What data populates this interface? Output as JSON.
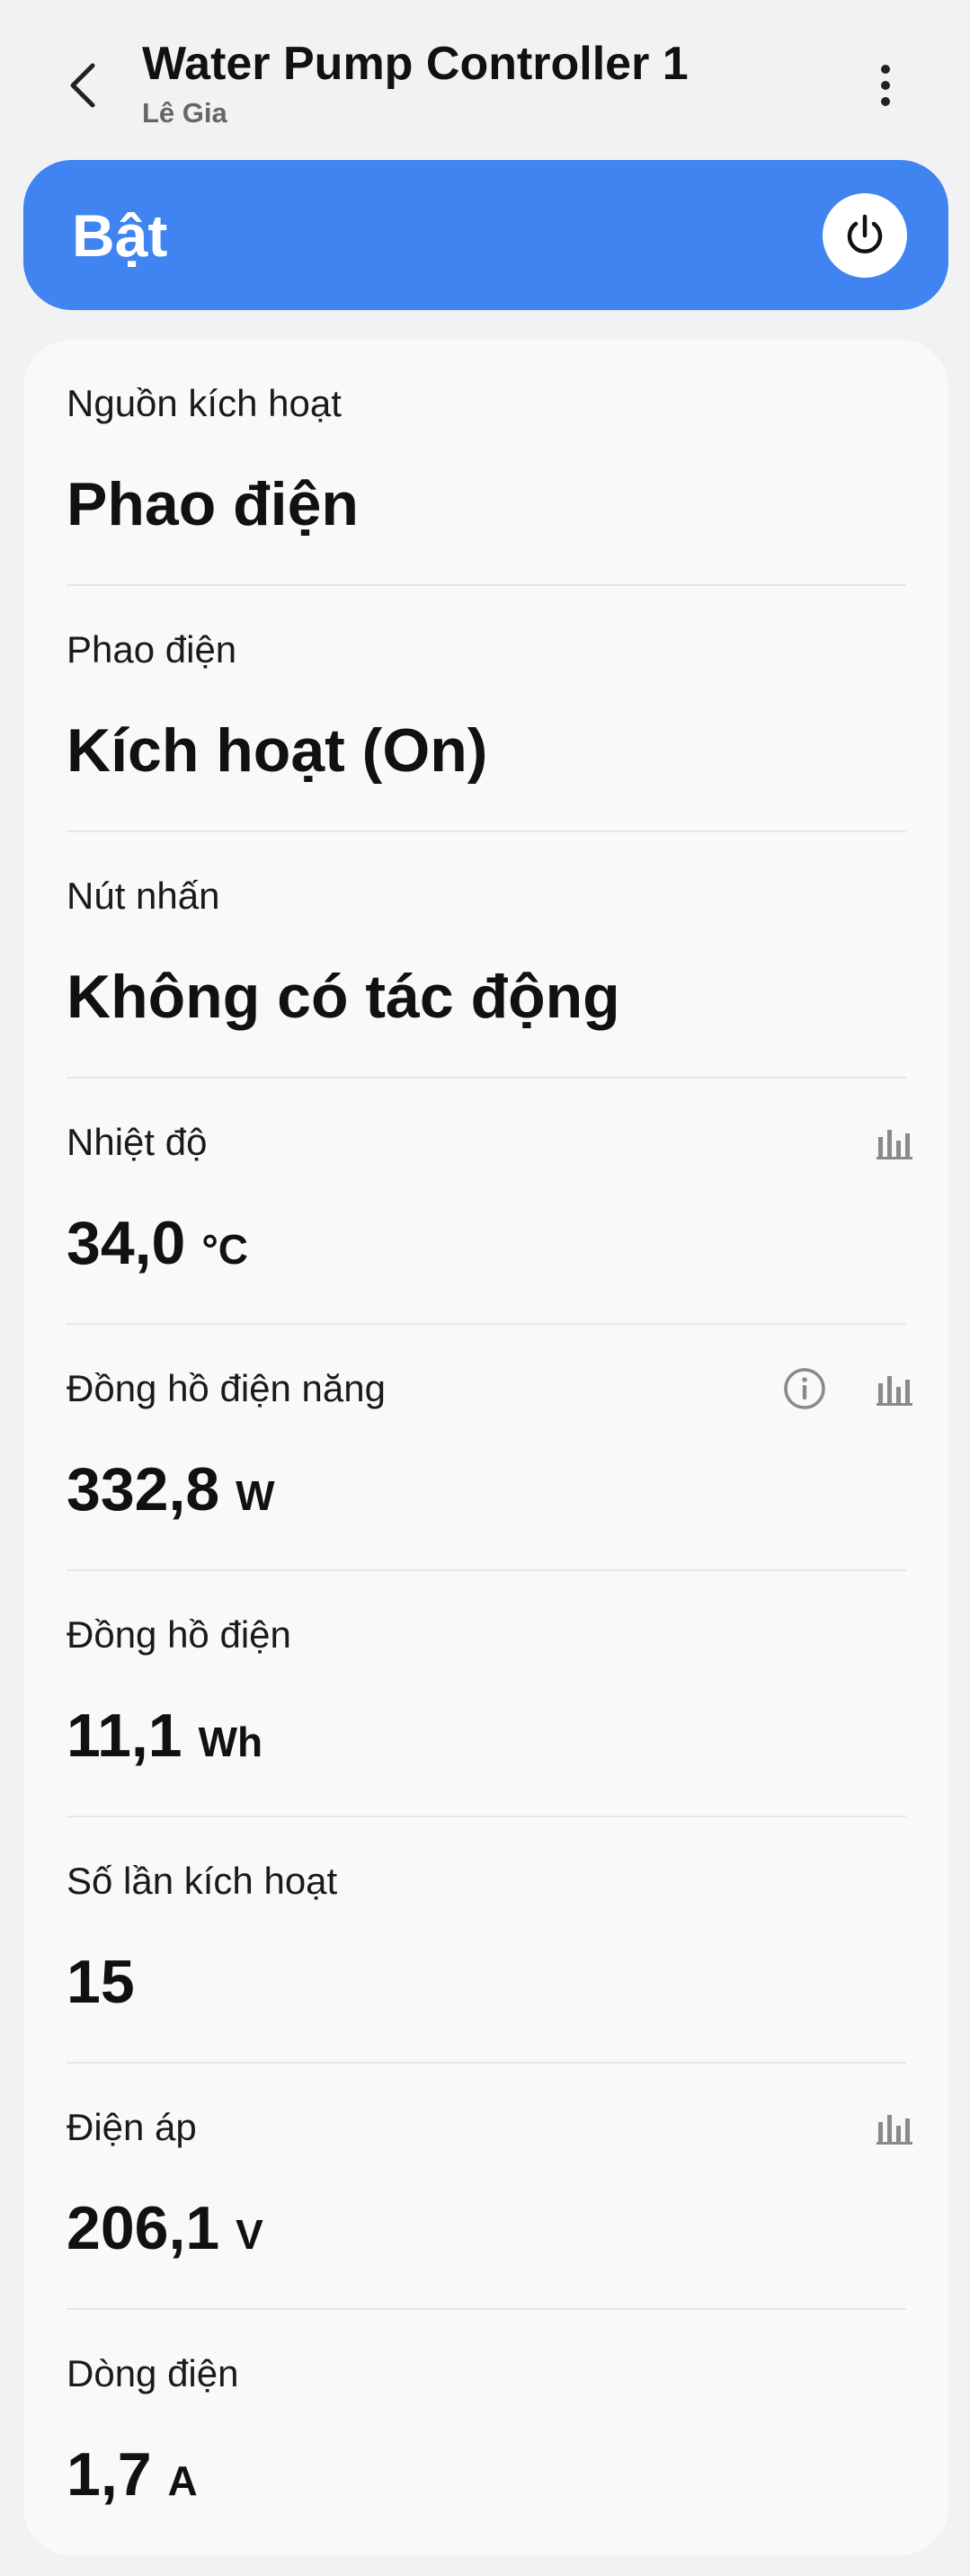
{
  "header": {
    "title": "Water Pump Controller 1",
    "subtitle": "Lê Gia",
    "back_icon": "chevron-left-icon",
    "more_icon": "more-vertical-icon"
  },
  "power": {
    "label": "Bật",
    "state": "on",
    "icon": "power-icon",
    "color": "#3f84f1"
  },
  "rows": [
    {
      "label": "Nguồn kích hoạt",
      "value": "Phao điện",
      "unit": ""
    },
    {
      "label": "Phao điện",
      "value": "Kích hoạt (On)",
      "unit": ""
    },
    {
      "label": "Nút nhấn",
      "value": "Không có tác động",
      "unit": ""
    },
    {
      "label": "Nhiệt độ",
      "value": "34,0",
      "unit": "°C",
      "icons": [
        "bar-chart-icon"
      ]
    },
    {
      "label": "Đồng hồ điện năng",
      "value": "332,8",
      "unit": "W",
      "icons": [
        "info-icon",
        "bar-chart-icon"
      ]
    },
    {
      "label": "Đồng hồ điện",
      "value": "11,1",
      "unit": "Wh"
    },
    {
      "label": "Số lần kích hoạt",
      "value": "15",
      "unit": ""
    },
    {
      "label": "Điện áp",
      "value": "206,1",
      "unit": "V",
      "icons": [
        "bar-chart-icon"
      ]
    },
    {
      "label": "Dòng điện",
      "value": "1,7",
      "unit": "A"
    }
  ]
}
